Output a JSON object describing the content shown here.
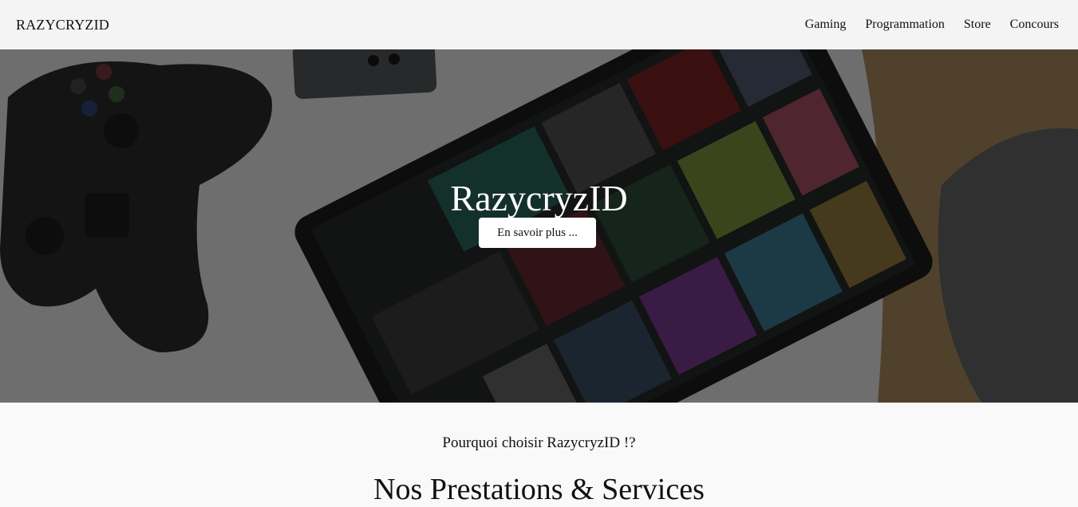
{
  "header": {
    "brand": "RAZYCRYZID",
    "nav": [
      "Gaming",
      "Programmation",
      "Store",
      "Concours"
    ]
  },
  "hero": {
    "title": "RazycryzID",
    "button_label": "En savoir plus ...",
    "image_description_icon": "gaming-tablet-controller-photo"
  },
  "section": {
    "why": "Pourquoi choisir RazycryzID !?",
    "title": "Nos Prestations & Services"
  },
  "colors": {
    "header_bg": "#f4f4f4",
    "page_bg": "#f9f9f9",
    "button_bg": "#ffffff",
    "hero_overlay": "#000000"
  }
}
